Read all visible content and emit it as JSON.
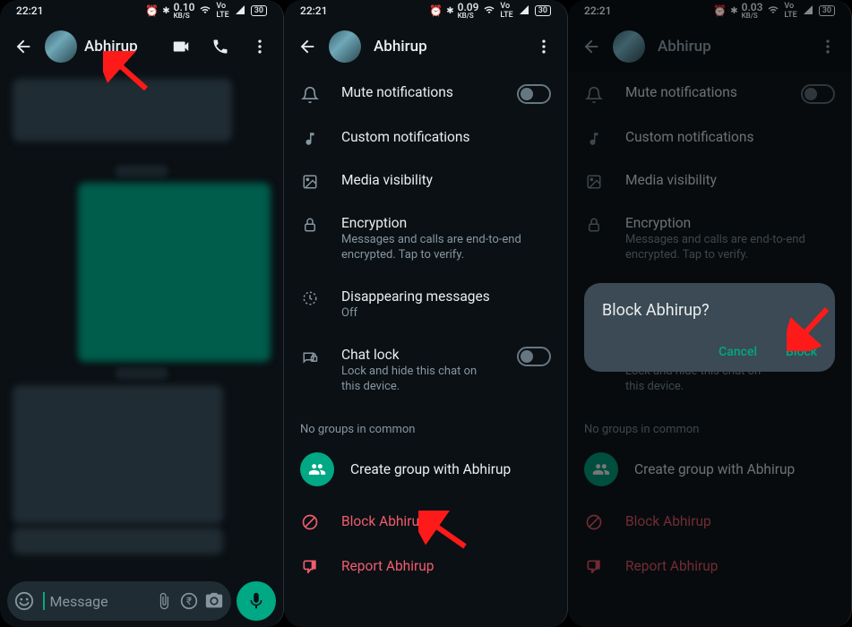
{
  "status": {
    "time": "22:21",
    "kbps1": "0.10",
    "kbps2": "0.09",
    "kbps3": "0.03",
    "kbps_unit": "KB/S",
    "battery": "30"
  },
  "contact_name": "Abhirup",
  "chat": {
    "placeholder": "Message"
  },
  "settings": {
    "mute": "Mute notifications",
    "custom": "Custom notifications",
    "media": "Media visibility",
    "enc": "Encryption",
    "enc_sub": "Messages and calls are end-to-end encrypted. Tap to verify.",
    "disap": "Disappearing messages",
    "disap_sub": "Off",
    "lock": "Chat lock",
    "lock_sub": "Lock and hide this chat on this device.",
    "nogroups": "No groups in common",
    "create": "Create group with Abhirup",
    "block": "Block Abhirup",
    "report": "Report Abhirup"
  },
  "dialog": {
    "title": "Block Abhirup?",
    "cancel": "Cancel",
    "confirm": "Block"
  }
}
